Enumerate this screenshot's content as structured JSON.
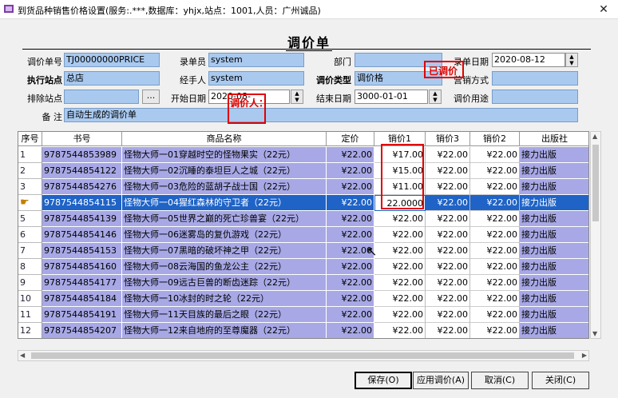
{
  "window": {
    "title": "到货品种销售价格设置(服务:.***,数据库：yhjx,站点：1001,人员：广州诚品)",
    "close_glyph": "✕"
  },
  "form": {
    "title": "调价单",
    "fields": {
      "doc_no_label": "调价单号",
      "doc_no": "TJ00000000PRICE",
      "entry_user_label": "录单员",
      "entry_user": "system",
      "dept_label": "部门",
      "dept": "",
      "entry_date_label": "录单日期",
      "entry_date": "2020-08-12",
      "exec_site_label": "执行站点",
      "exec_site": "总店",
      "handler_label": "经手人",
      "handler": "system",
      "adj_type_label": "调价类型",
      "adj_type": "调价格",
      "sale_method_label": "营销方式",
      "sale_method": "",
      "exclude_site_label": "排除站点",
      "exclude_site": "",
      "dots": "...",
      "start_date_label": "开始日期",
      "start_date": "2020-08-",
      "end_date_label": "结束日期",
      "end_date": "3000-01-01",
      "purpose_label": "调价用途",
      "purpose": "",
      "remark_label": "备 注",
      "remark": "自动生成的调价单"
    },
    "stamps": {
      "adjusted": "已调价",
      "adjuster": "调价人："
    }
  },
  "grid": {
    "columns": [
      "序号",
      "书号",
      "商品名称",
      "定价",
      "销价1",
      "销价3",
      "销价2",
      "出版社"
    ],
    "rows": [
      {
        "no": "1",
        "isbn": "9787544853989",
        "name": "怪物大师一01穿越时空的怪物果实（22元）",
        "price": "¥22.00",
        "p1": "¥17.00",
        "p3": "¥22.00",
        "p2": "¥22.00",
        "pub": "接力出版"
      },
      {
        "no": "2",
        "isbn": "9787544854122",
        "name": "怪物大师一02沉睡的泰坦巨人之城（22元）",
        "price": "¥22.00",
        "p1": "¥15.00",
        "p3": "¥22.00",
        "p2": "¥22.00",
        "pub": "接力出版"
      },
      {
        "no": "3",
        "isbn": "9787544854276",
        "name": "怪物大师一03危险的蓝胡子战士国（22元）",
        "price": "¥22.00",
        "p1": "¥11.00",
        "p3": "¥22.00",
        "p2": "¥22.00",
        "pub": "接力出版"
      },
      {
        "no": "",
        "isbn": "9787544854115",
        "name": "怪物大师一04猩红森林的守卫者（22元）",
        "price": "¥22.00",
        "p1": "22.0000",
        "p3": "¥22.00",
        "p2": "¥22.00",
        "pub": "接力出版"
      },
      {
        "no": "5",
        "isbn": "9787544854139",
        "name": "怪物大师一05世界之巅的死亡珍兽宴（22元）",
        "price": "¥22.00",
        "p1": "¥22.00",
        "p3": "¥22.00",
        "p2": "¥22.00",
        "pub": "接力出版"
      },
      {
        "no": "6",
        "isbn": "9787544854146",
        "name": "怪物大师一06迷雾岛的复仇游戏（22元）",
        "price": "¥22.00",
        "p1": "¥22.00",
        "p3": "¥22.00",
        "p2": "¥22.00",
        "pub": "接力出版"
      },
      {
        "no": "7",
        "isbn": "9787544854153",
        "name": "怪物大师一07黑暗的破坏神之甲（22元）",
        "price": "¥22.00",
        "p1": "¥22.00",
        "p3": "¥22.00",
        "p2": "¥22.00",
        "pub": "接力出版"
      },
      {
        "no": "8",
        "isbn": "9787544854160",
        "name": "怪物大师一08云海国的鱼龙公主（22元）",
        "price": "¥22.00",
        "p1": "¥22.00",
        "p3": "¥22.00",
        "p2": "¥22.00",
        "pub": "接力出版"
      },
      {
        "no": "9",
        "isbn": "9787544854177",
        "name": "怪物大师一09远古巨兽的断齿迷踪（22元）",
        "price": "¥22.00",
        "p1": "¥22.00",
        "p3": "¥22.00",
        "p2": "¥22.00",
        "pub": "接力出版"
      },
      {
        "no": "10",
        "isbn": "9787544854184",
        "name": "怪物大师一10冰封的时之轮（22元）",
        "price": "¥22.00",
        "p1": "¥22.00",
        "p3": "¥22.00",
        "p2": "¥22.00",
        "pub": "接力出版"
      },
      {
        "no": "11",
        "isbn": "9787544854191",
        "name": "怪物大师一11天目族的最后之眼（22元）",
        "price": "¥22.00",
        "p1": "¥22.00",
        "p3": "¥22.00",
        "p2": "¥22.00",
        "pub": "接力出版"
      },
      {
        "no": "12",
        "isbn": "9787544854207",
        "name": "怪物大师一12来自地府的至尊魔器（22元）",
        "price": "¥22.00",
        "p1": "¥22.00",
        "p3": "¥22.00",
        "p2": "¥22.00",
        "pub": "接力出版"
      }
    ],
    "selected_row_index": 3
  },
  "buttons": {
    "save": "保存(O)",
    "apply": "应用调价(A)",
    "cancel": "取消(C)",
    "close": "关闭(C)"
  },
  "colors": {
    "field_blue": "#a9c9ef",
    "row_blue": "#a8a8e6",
    "selected": "#1f63c6",
    "stamp_red": "#e00000"
  },
  "icons": {
    "app": "app-icon",
    "row_pointer": "pointing-hand-icon",
    "cursor": "mouse-cursor-icon"
  }
}
